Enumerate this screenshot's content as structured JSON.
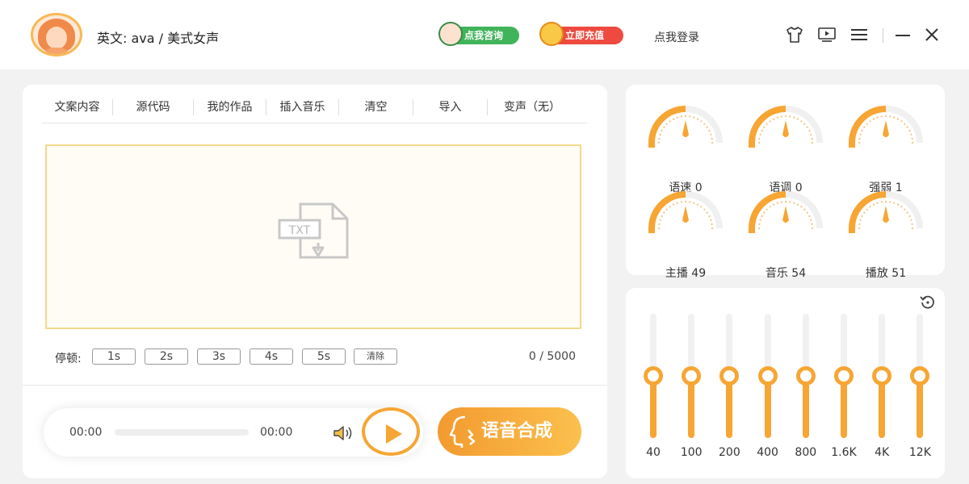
{
  "header": {
    "voice_title": "英文: ava / 美式女声",
    "consult_label": "点我咨询",
    "recharge_label": "立即充值",
    "login_label": "点我登录",
    "icons": [
      "tshirt-icon",
      "screen-icon",
      "menu-icon",
      "minimize-icon",
      "close-icon"
    ]
  },
  "tabs": [
    {
      "label": "文案内容"
    },
    {
      "label": "源代码"
    },
    {
      "label": "我的作品"
    },
    {
      "label": "插入音乐"
    },
    {
      "label": "清空"
    },
    {
      "label": "导入"
    },
    {
      "label": "变声（无）"
    }
  ],
  "editor": {
    "icon_text": "TXT"
  },
  "pause": {
    "label": "停顿:",
    "buttons": [
      "1s",
      "2s",
      "3s",
      "4s",
      "5s"
    ],
    "clear_label": "清除",
    "counter": "0 / 5000"
  },
  "player": {
    "current_time": "00:00",
    "total_time": "00:00",
    "progress": 0
  },
  "synth_label": "语音合成",
  "dials": [
    {
      "label": "语速 0",
      "level": 0.5
    },
    {
      "label": "语调 0",
      "level": 0.5
    },
    {
      "label": "强弱 1",
      "level": 0.5
    },
    {
      "label": "主播 49",
      "level": 0.5
    },
    {
      "label": "音乐 54",
      "level": 0.5
    },
    {
      "label": "播放 51",
      "level": 0.5
    }
  ],
  "equalizer": {
    "bands": [
      {
        "freq": "40",
        "level": 0.5
      },
      {
        "freq": "100",
        "level": 0.5
      },
      {
        "freq": "200",
        "level": 0.5
      },
      {
        "freq": "400",
        "level": 0.5
      },
      {
        "freq": "800",
        "level": 0.5
      },
      {
        "freq": "1.6K",
        "level": 0.5
      },
      {
        "freq": "4K",
        "level": 0.5
      },
      {
        "freq": "12K",
        "level": 0.5
      }
    ]
  },
  "colors": {
    "accent": "#f7a533",
    "consult": "#41b35a",
    "recharge": "#ee4a3f",
    "editor_border": "#f5d98a"
  }
}
